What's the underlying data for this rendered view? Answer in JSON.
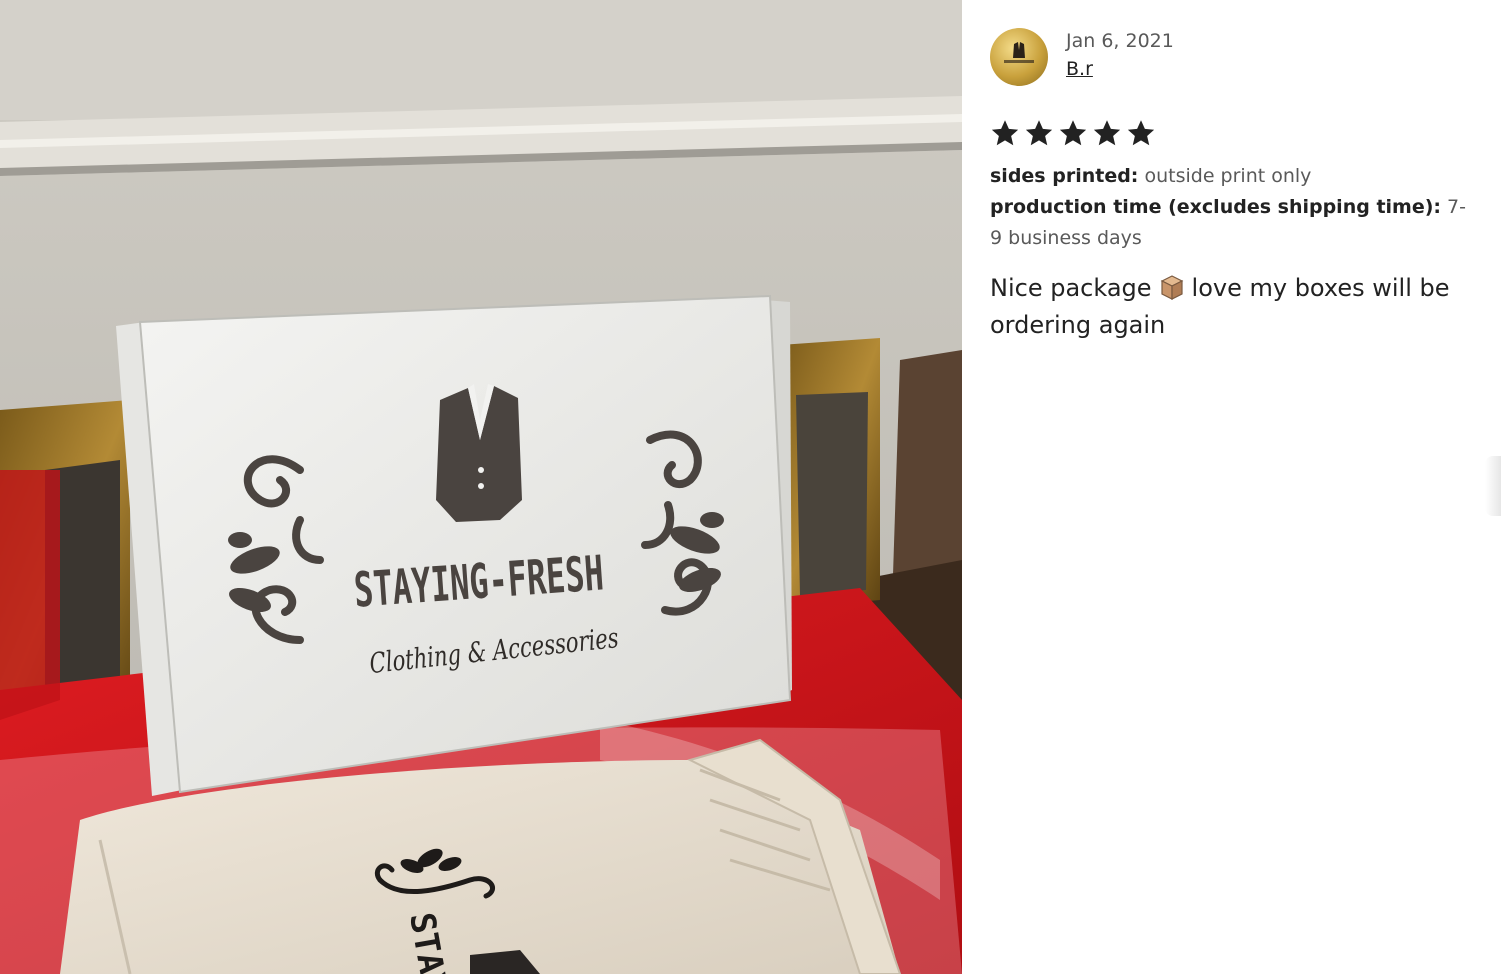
{
  "photo": {
    "box_brand": "STAYING-FRESH",
    "box_tagline": "Clothing & Accessories",
    "bag_brand_partial": "STAY"
  },
  "review": {
    "date": "Jan 6, 2021",
    "reviewer": "B.r",
    "rating": 5,
    "rating_max": 5,
    "meta": [
      {
        "label": "sides printed:",
        "value": "outside print only"
      },
      {
        "label": "production time (excludes shipping time):",
        "value": "7-9 business days"
      }
    ],
    "text_before_emoji": "Nice package",
    "emoji": "package-icon",
    "text_after_emoji": "love my boxes will be ordering again"
  },
  "colors": {
    "star": "#222222",
    "avatar_gold": "#c9a13c",
    "table_red": "#d8141a"
  }
}
